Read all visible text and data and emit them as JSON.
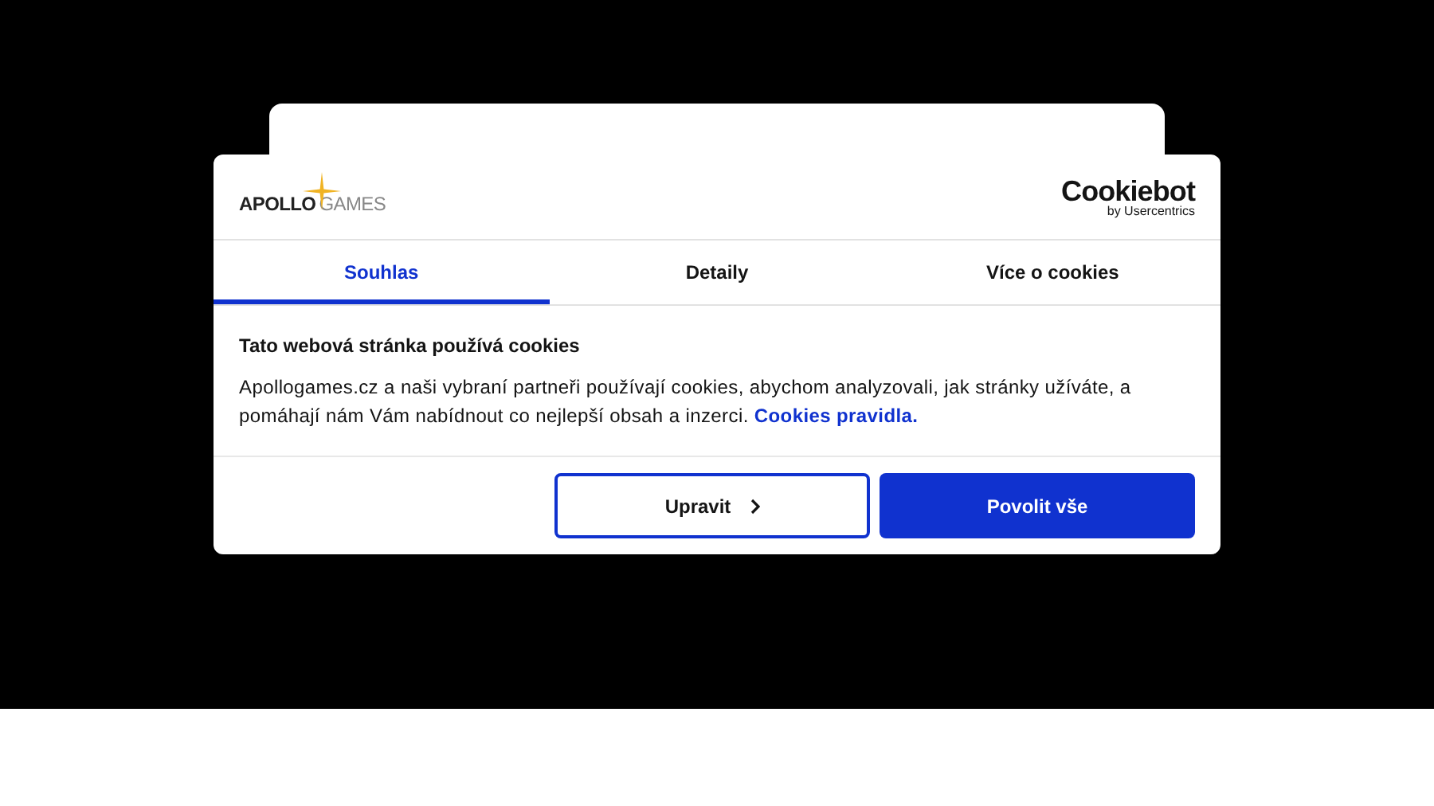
{
  "logo": {
    "left": "APOLLO",
    "right": "GAMES"
  },
  "provider": {
    "name": "Cookiebot",
    "byline": "by Usercentrics"
  },
  "tabs": [
    {
      "label": "Souhlas",
      "selected": true
    },
    {
      "label": "Detaily",
      "selected": false
    },
    {
      "label": "Více o cookies",
      "selected": false
    }
  ],
  "heading": "Tato webová stránka používá cookies",
  "body": "Apollogames.cz a naši vybraní partneři používají cookies, abychom analyzovali, jak stránky užíváte, a pomáhají nám Vám nabídnout co nejlepší obsah a inzerci.",
  "policy_link": "Cookies pravidla.",
  "buttons": [
    {
      "label": "Upravit",
      "kind": "outline"
    },
    {
      "label": "Povolit vše",
      "kind": "primary"
    }
  ]
}
